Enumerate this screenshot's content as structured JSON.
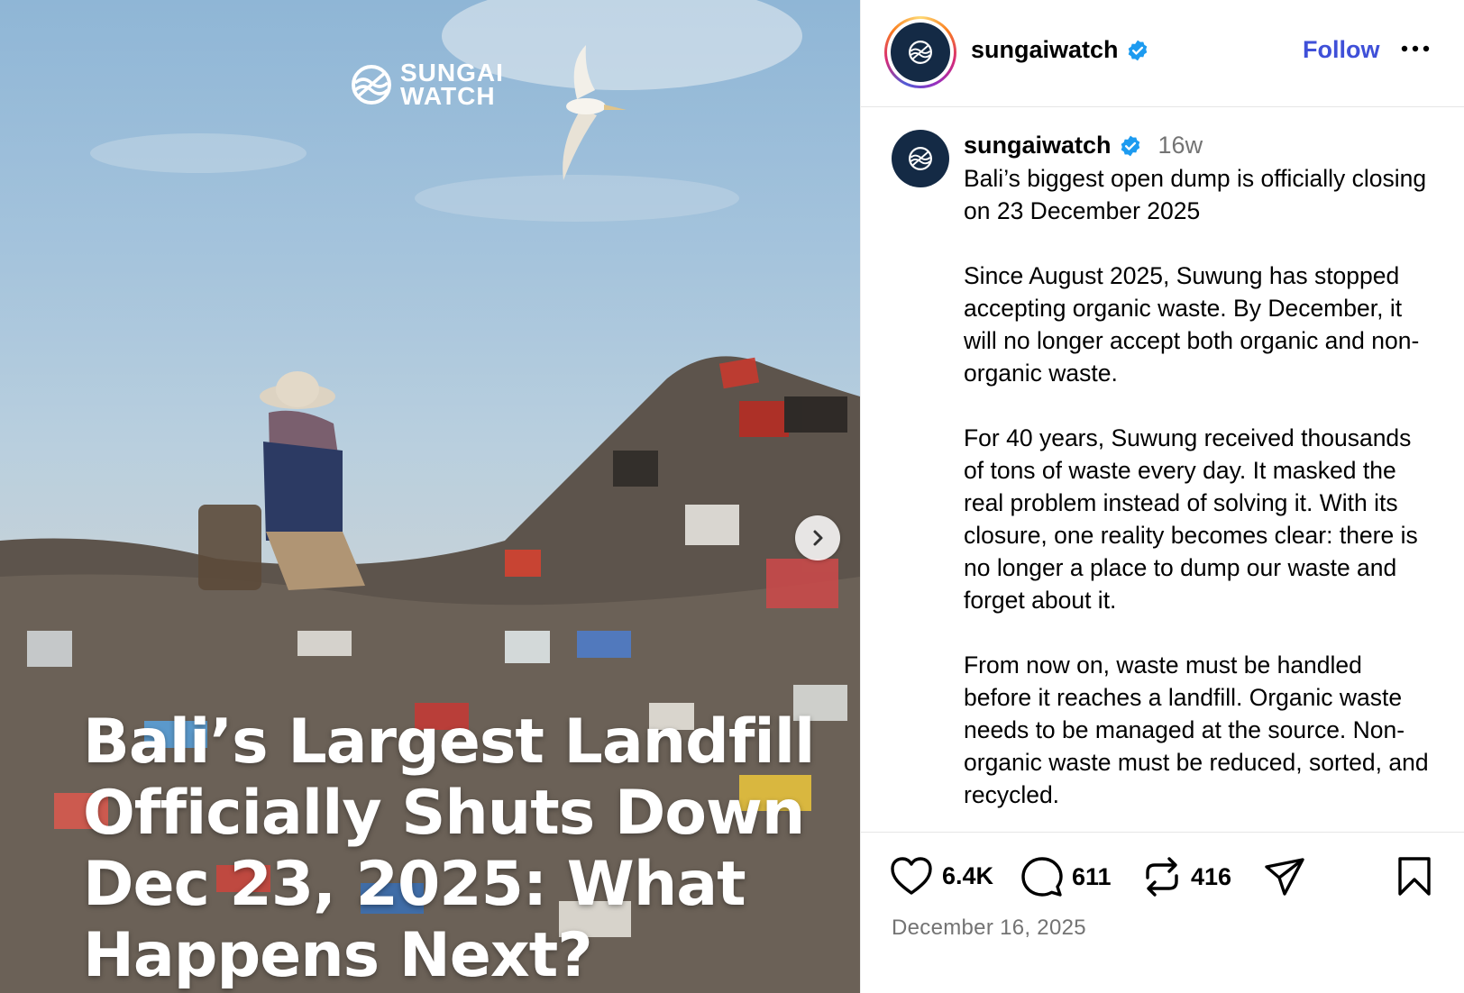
{
  "post": {
    "image": {
      "brand_line1": "SUNGAI",
      "brand_line2": "WATCH",
      "headline": "Bali’s Largest Landfill Officially Shuts Down Dec 23, 2025: What Happens Next?"
    },
    "header": {
      "username": "sungaiwatch",
      "follow_label": "Follow"
    },
    "caption": {
      "username": "sungaiwatch",
      "age": "16w",
      "paragraphs": [
        "Bali’s biggest open dump is officially closing on 23 December 2025",
        "Since August 2025, Suwung has stopped accepting organic waste. By December, it will no longer accept both organic and non-organic waste.",
        "For 40 years, Suwung received thousands of tons of waste every day. It masked the real problem instead of solving it. With its closure, one reality becomes clear: there is no longer a place to dump our waste and forget about it.",
        "From now on, waste must be handled before it reaches a landfill. Organic waste needs to be managed at the source. Non-organic waste must be reduced, sorted, and recycled."
      ]
    },
    "counts": {
      "likes": "6.4K",
      "comments": "611",
      "reposts": "416"
    },
    "date": "December 16, 2025"
  },
  "colors": {
    "follow": "#3f50d8",
    "verified": "#1d9bf0",
    "avatar_bg": "#142a45",
    "muted": "#737373"
  },
  "icons": [
    "sungai-logo-icon",
    "verified-badge-icon",
    "more-options-icon",
    "chevron-right-icon",
    "heart-icon",
    "comment-icon",
    "repost-icon",
    "share-icon",
    "bookmark-icon"
  ]
}
